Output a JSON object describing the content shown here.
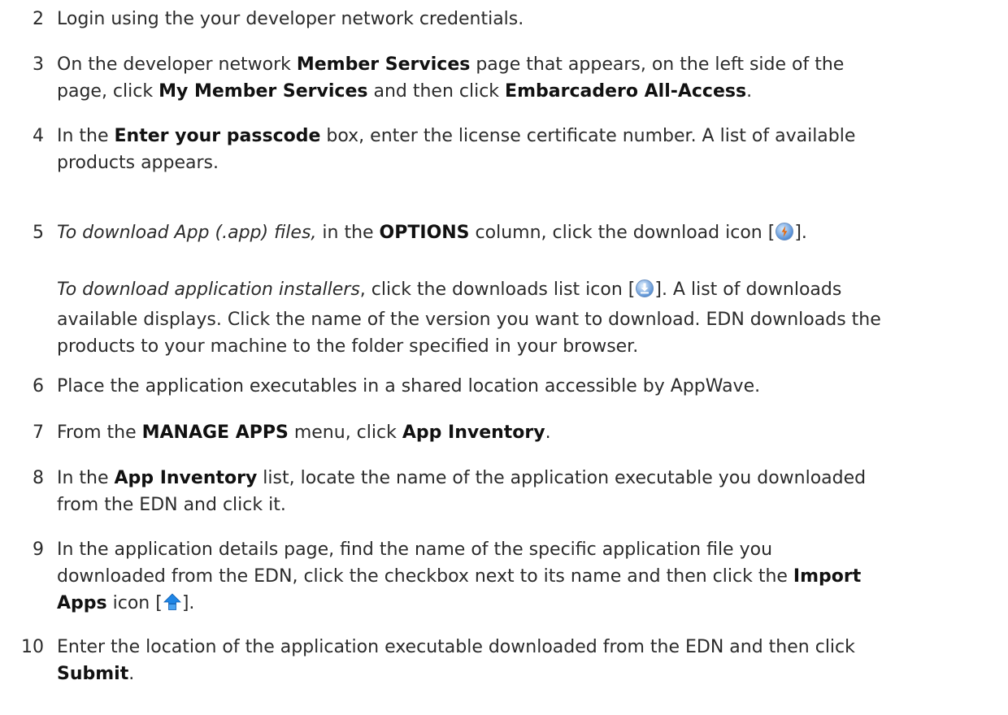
{
  "steps": [
    {
      "number": "2",
      "lines": [
        [
          {
            "t": "Login using the your developer network credentials."
          }
        ]
      ]
    },
    {
      "number": "3",
      "lines": [
        [
          {
            "t": "On the developer network "
          },
          {
            "t": "Member Services",
            "b": true
          },
          {
            "t": " page that appears, on the left side of the"
          }
        ],
        [
          {
            "t": "page, click "
          },
          {
            "t": "My Member Services",
            "b": true
          },
          {
            "t": " and then click "
          },
          {
            "t": "Embarcadero All-Access",
            "b": true
          },
          {
            "t": "."
          }
        ]
      ]
    },
    {
      "number": "4",
      "lines": [
        [
          {
            "t": "In the "
          },
          {
            "t": "Enter your passcode",
            "b": true
          },
          {
            "t": " box, enter the license certificate number. A list of available"
          }
        ],
        [
          {
            "t": "products appears."
          }
        ]
      ]
    },
    {
      "number": "5",
      "lines": [
        [
          {
            "t": "To download App (.app) files,",
            "i": true
          },
          {
            "t": " in the "
          },
          {
            "t": "OPTIONS",
            "b": true
          },
          {
            "t": " column, click the download icon ["
          },
          {
            "icon": "download-icon"
          },
          {
            "t": "]."
          }
        ]
      ]
    },
    {
      "number": "",
      "lines": [
        [
          {
            "t": "To download application installers",
            "i": true
          },
          {
            "t": ", click the downloads list icon ["
          },
          {
            "icon": "downloads-list-icon"
          },
          {
            "t": "]. A list of downloads"
          }
        ],
        [
          {
            "t": "available displays. Click the name of the version you want to download. EDN downloads the"
          }
        ],
        [
          {
            "t": "products to your machine to the folder specified in your browser."
          }
        ]
      ]
    },
    {
      "number": "6",
      "lines": [
        [
          {
            "t": "Place the application executables in a shared location accessible by AppWave."
          }
        ]
      ]
    },
    {
      "number": "7",
      "lines": [
        [
          {
            "t": "From the "
          },
          {
            "t": "MANAGE APPS",
            "b": true
          },
          {
            "t": " menu, click "
          },
          {
            "t": "App Inventory",
            "b": true
          },
          {
            "t": "."
          }
        ]
      ]
    },
    {
      "number": "8",
      "lines": [
        [
          {
            "t": "In the "
          },
          {
            "t": "App Inventory",
            "b": true
          },
          {
            "t": " list, locate the name of the application executable you downloaded"
          }
        ],
        [
          {
            "t": "from the EDN and click it."
          }
        ]
      ]
    },
    {
      "number": "9",
      "lines": [
        [
          {
            "t": "In the application details page, find the name of the specific application file you"
          }
        ],
        [
          {
            "t": "downloaded from the EDN, click the checkbox next to its name and then click the "
          },
          {
            "t": "Import",
            "b": true
          }
        ],
        [
          {
            "t": "Apps",
            "b": true
          },
          {
            "t": " icon ["
          },
          {
            "icon": "import-apps-icon"
          },
          {
            "t": "]."
          }
        ]
      ]
    },
    {
      "number": "10",
      "lines": [
        [
          {
            "t": "Enter the location of the application executable downloaded from the EDN and then click"
          }
        ],
        [
          {
            "t": "Submit",
            "b": true
          },
          {
            "t": "."
          }
        ]
      ]
    }
  ]
}
